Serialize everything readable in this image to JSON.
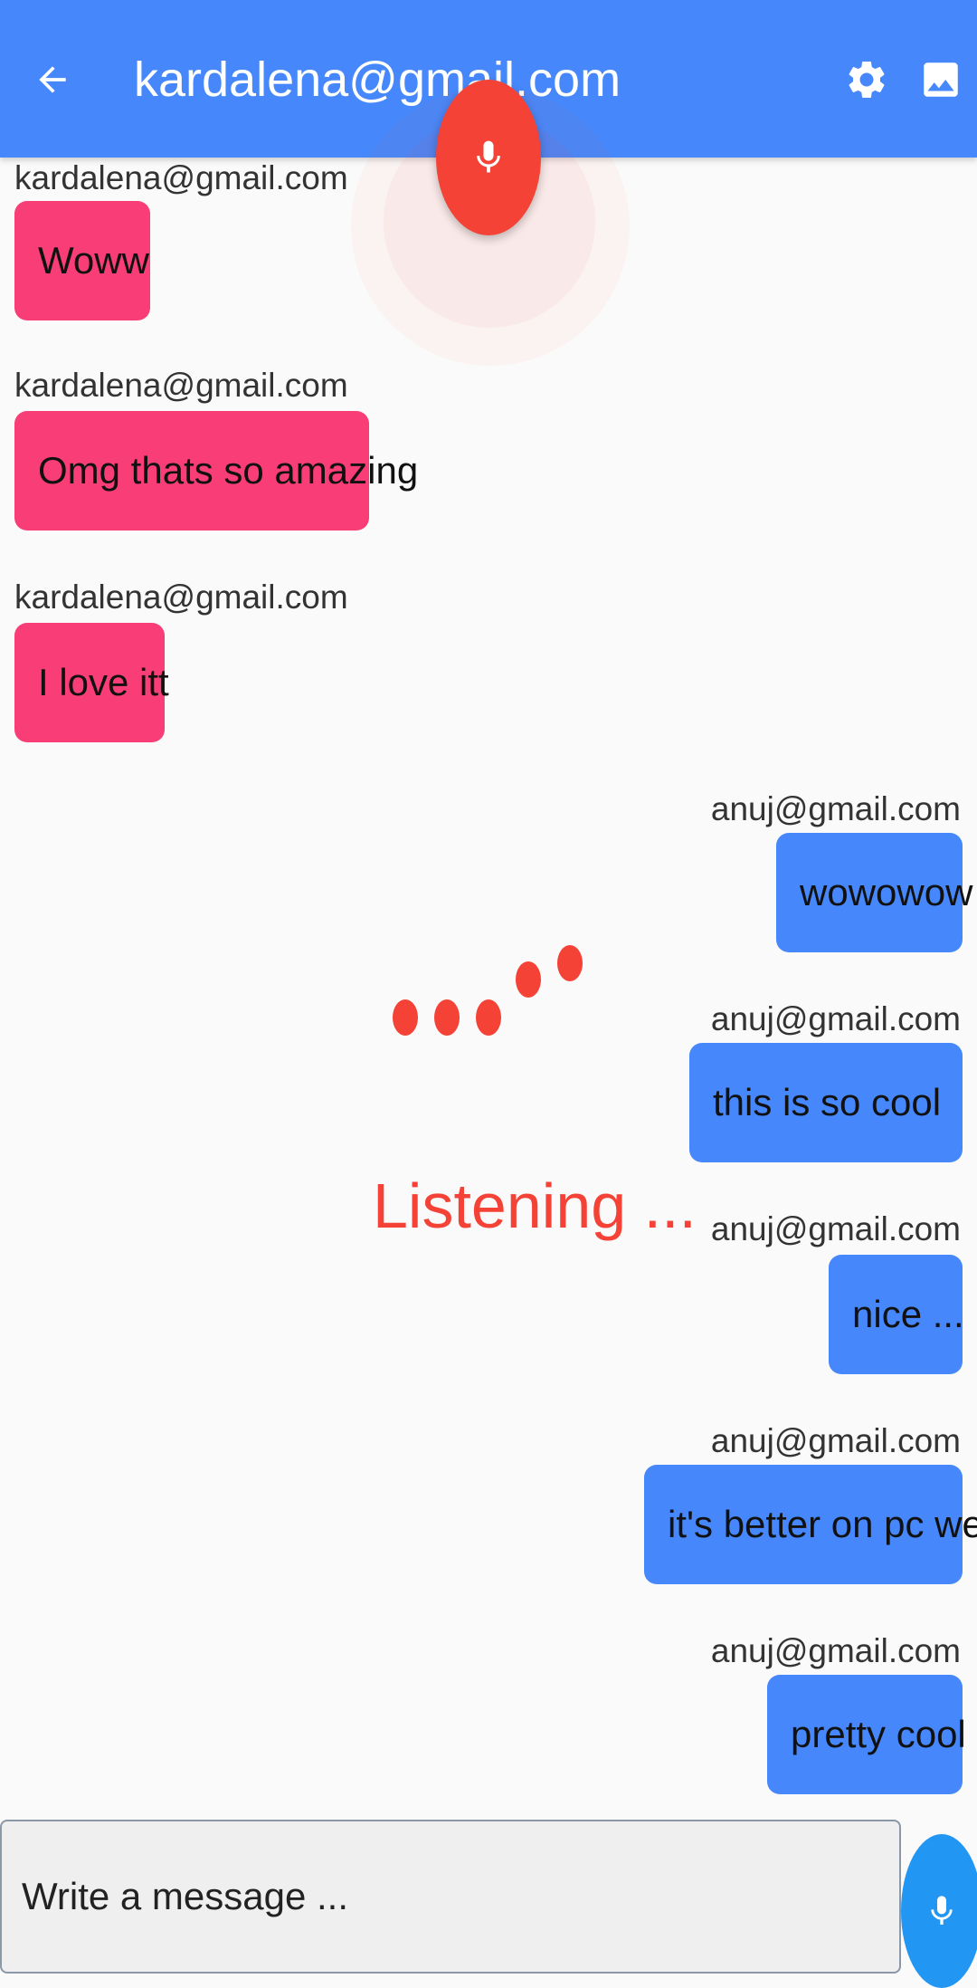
{
  "app_bar": {
    "title": "kardalena@gmail.com",
    "color": "#4688fb",
    "back_icon": "arrow-back-icon",
    "settings_icon": "gear-icon",
    "image_icon": "image-icon"
  },
  "voice": {
    "mic_icon": "microphone-icon",
    "status": "Listening ...",
    "accent": "#f44336"
  },
  "messages": [
    {
      "sender": "kardalena@gmail.com",
      "text": "Woww",
      "direction": "incoming"
    },
    {
      "sender": "kardalena@gmail.com",
      "text": "Omg thats so amazing",
      "direction": "incoming"
    },
    {
      "sender": "kardalena@gmail.com",
      "text": "I love itt",
      "direction": "incoming"
    },
    {
      "sender": "anuj@gmail.com",
      "text": "wowowow",
      "direction": "outgoing"
    },
    {
      "sender": "anuj@gmail.com",
      "text": "this is so cool",
      "direction": "outgoing"
    },
    {
      "sender": "anuj@gmail.com",
      "text": "nice ...",
      "direction": "outgoing"
    },
    {
      "sender": "anuj@gmail.com",
      "text": "it's better on pc web",
      "direction": "outgoing"
    },
    {
      "sender": "anuj@gmail.com",
      "text": "pretty cool",
      "direction": "outgoing"
    }
  ],
  "colors": {
    "incoming_bubble": "#f83d77",
    "outgoing_bubble": "#4688fb"
  },
  "composer": {
    "placeholder": "Write a message ...",
    "mic_icon": "microphone-icon"
  }
}
